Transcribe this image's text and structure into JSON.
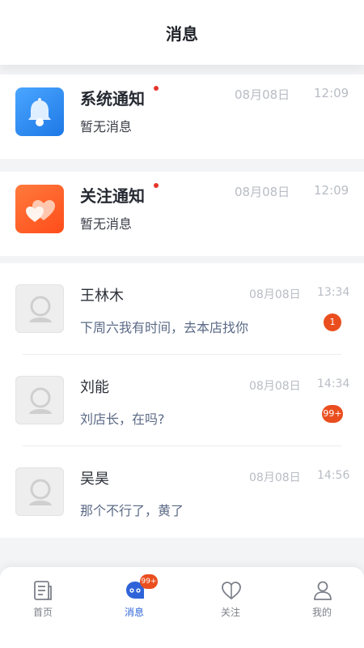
{
  "header": {
    "title": "消息"
  },
  "notices": [
    {
      "title": "系统通知",
      "subtitle": "暂无消息",
      "date": "08月08日",
      "time": "12:09",
      "icon": "bell-icon",
      "color": "#2c8cf4",
      "unread": true
    },
    {
      "title": "关注通知",
      "subtitle": "暂无消息",
      "date": "08月08日",
      "time": "12:09",
      "icon": "hearts-icon",
      "color": "#ff5a23",
      "unread": true
    }
  ],
  "chats": [
    {
      "name": "王林木",
      "message": "下周六我有时间，去本店找你",
      "date": "08月08日",
      "time": "13:34",
      "badge": "1"
    },
    {
      "name": "刘能",
      "message": "刘店长，在吗?",
      "date": "08月08日",
      "time": "14:34",
      "badge": "99+"
    },
    {
      "name": "吴昊",
      "message": "那个不行了，黄了",
      "date": "08月08日",
      "time": "14:56",
      "badge": ""
    }
  ],
  "tabbar": {
    "tabs": [
      {
        "label": "首页",
        "icon": "document-icon",
        "active": false
      },
      {
        "label": "消息",
        "icon": "chat-icon",
        "active": true,
        "badge": "99+"
      },
      {
        "label": "关注",
        "icon": "heart-outline-icon",
        "active": false
      },
      {
        "label": "我的",
        "icon": "person-icon",
        "active": false
      }
    ]
  },
  "colors": {
    "accent": "#2f64d8",
    "badge": "#ea4e1e",
    "unread_dot": "#e5352b"
  }
}
